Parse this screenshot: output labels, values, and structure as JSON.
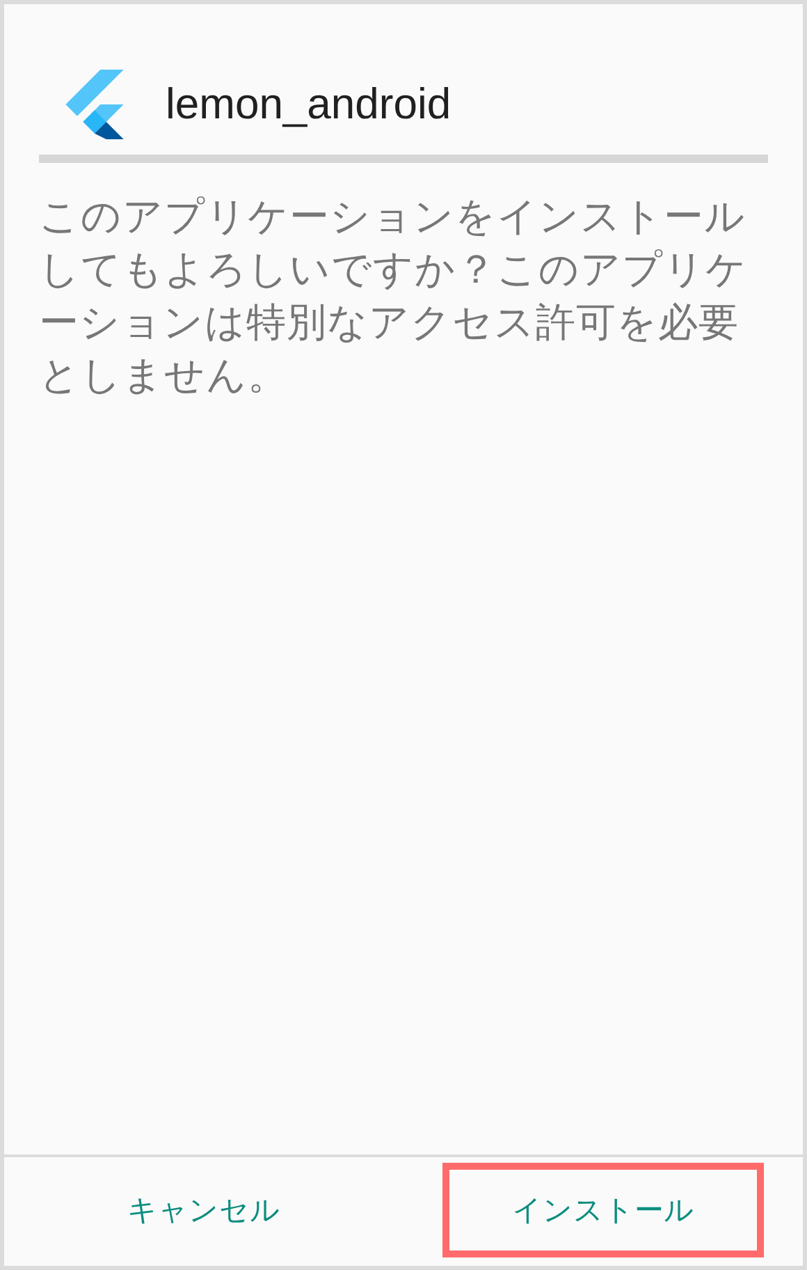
{
  "header": {
    "title": "lemon_android"
  },
  "message": "このアプリケーションをインストールしてもよろしいですか？このアプリケーションは特別なアクセス許可を必要としません。",
  "buttons": [
    {
      "label": "キャンセル",
      "highlighted": false
    },
    {
      "label": "インストール",
      "highlighted": true
    }
  ]
}
